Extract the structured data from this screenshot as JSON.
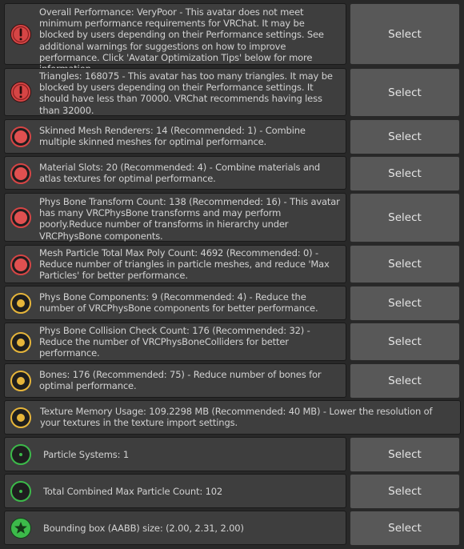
{
  "button_label": "Select",
  "colors": {
    "error": "#d64545",
    "warning": "#e6b53a",
    "info": "#3cba4a",
    "good": "#3cba4a"
  },
  "items": [
    {
      "level": "error-icon",
      "message": "Overall Performance: VeryPoor - This avatar does not meet minimum performance requirements for VRChat. It may be blocked by users depending on their Performance settings. See additional warnings for suggestions on how to improve performance. Click 'Avatar Optimization Tips' below for more information."
    },
    {
      "level": "error-icon",
      "message": "Triangles: 168075 - This avatar has too many triangles. It may be blocked by users depending on their Performance settings. It should have less than 70000. VRChat recommends having less than 32000."
    },
    {
      "level": "very-poor-icon",
      "message": "Skinned Mesh Renderers: 14 (Recommended: 1) - Combine multiple skinned meshes for optimal performance."
    },
    {
      "level": "very-poor-icon",
      "message": "Material Slots: 20 (Recommended: 4) - Combine materials and atlas textures for optimal performance."
    },
    {
      "level": "very-poor-icon",
      "message": "Phys Bone Transform Count: 138 (Recommended: 16) - This avatar has many VRCPhysBone transforms and may perform poorly.Reduce number of transforms in hierarchy under VRCPhysBone components."
    },
    {
      "level": "very-poor-icon",
      "message": "Mesh Particle Total Max Poly Count: 4692 (Recommended: 0) - Reduce number of triangles in particle meshes, and reduce 'Max Particles' for better performance."
    },
    {
      "level": "poor-icon",
      "message": "Phys Bone Components: 9 (Recommended: 4) - Reduce the number of VRCPhysBone components for better performance."
    },
    {
      "level": "poor-icon",
      "message": "Phys Bone Collision Check Count: 176 (Recommended: 32) - Reduce the number of VRCPhysBoneColliders for better performance."
    },
    {
      "level": "poor-icon",
      "message": "Bones: 176 (Recommended: 75) - Reduce number of bones for optimal performance."
    },
    {
      "level": "poor-icon",
      "message": "Texture Memory Usage: 109.2298 MB (Recommended: 40 MB) - Lower the resolution of your textures in the texture import settings."
    },
    {
      "level": "good-icon",
      "message": "Particle Systems: 1"
    },
    {
      "level": "good-icon",
      "message": "Total Combined Max Particle Count: 102"
    },
    {
      "level": "excellent-icon",
      "message": "Bounding box (AABB) size: (2.00, 2.31, 2.00)"
    }
  ]
}
